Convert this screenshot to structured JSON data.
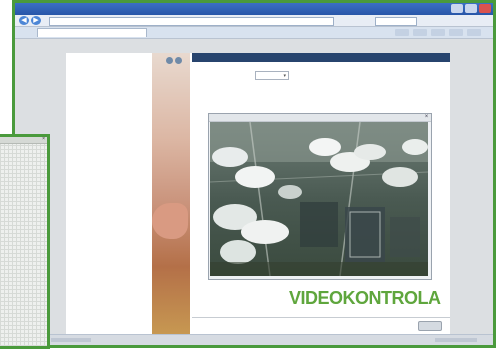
{
  "browser": {
    "title": "",
    "address": "",
    "tab_label": "",
    "nav": {
      "back": "◀",
      "forward": "▶"
    }
  },
  "app": {
    "menu": [
      {
        "label": "",
        "active": true
      },
      {
        "label": "",
        "active": false
      },
      {
        "label": "",
        "active": false
      },
      {
        "label": "",
        "active": false
      },
      {
        "label": "",
        "active": false
      }
    ],
    "panel_title": "",
    "field_label": "",
    "select_value": "",
    "select_caret": "▾",
    "camera_close": "×",
    "brand": "VIDEOKONTROLA",
    "footer_button": ""
  },
  "popup": {
    "close": "×"
  },
  "colors": {
    "frame_border": "#4a9a3c",
    "panel_header": "#27446e",
    "brand": "#5fa63d",
    "menu_active": "#5aa6d8"
  }
}
